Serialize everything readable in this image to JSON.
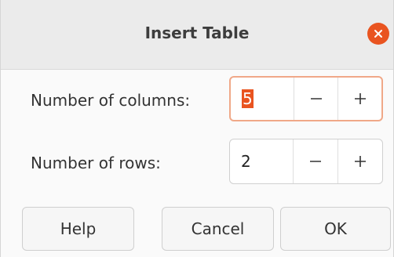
{
  "dialog": {
    "title": "Insert Table",
    "close_icon": "close-icon"
  },
  "fields": {
    "columns": {
      "label": "Number of columns:",
      "value": "5",
      "decrement_icon": "minus-icon",
      "increment_icon": "plus-icon"
    },
    "rows": {
      "label": "Number of rows:",
      "value": "2",
      "decrement_icon": "minus-icon",
      "increment_icon": "plus-icon"
    }
  },
  "buttons": {
    "help": "Help",
    "cancel": "Cancel",
    "ok": "OK"
  },
  "colors": {
    "accent": "#e95420",
    "focus_border": "#f0a888"
  }
}
